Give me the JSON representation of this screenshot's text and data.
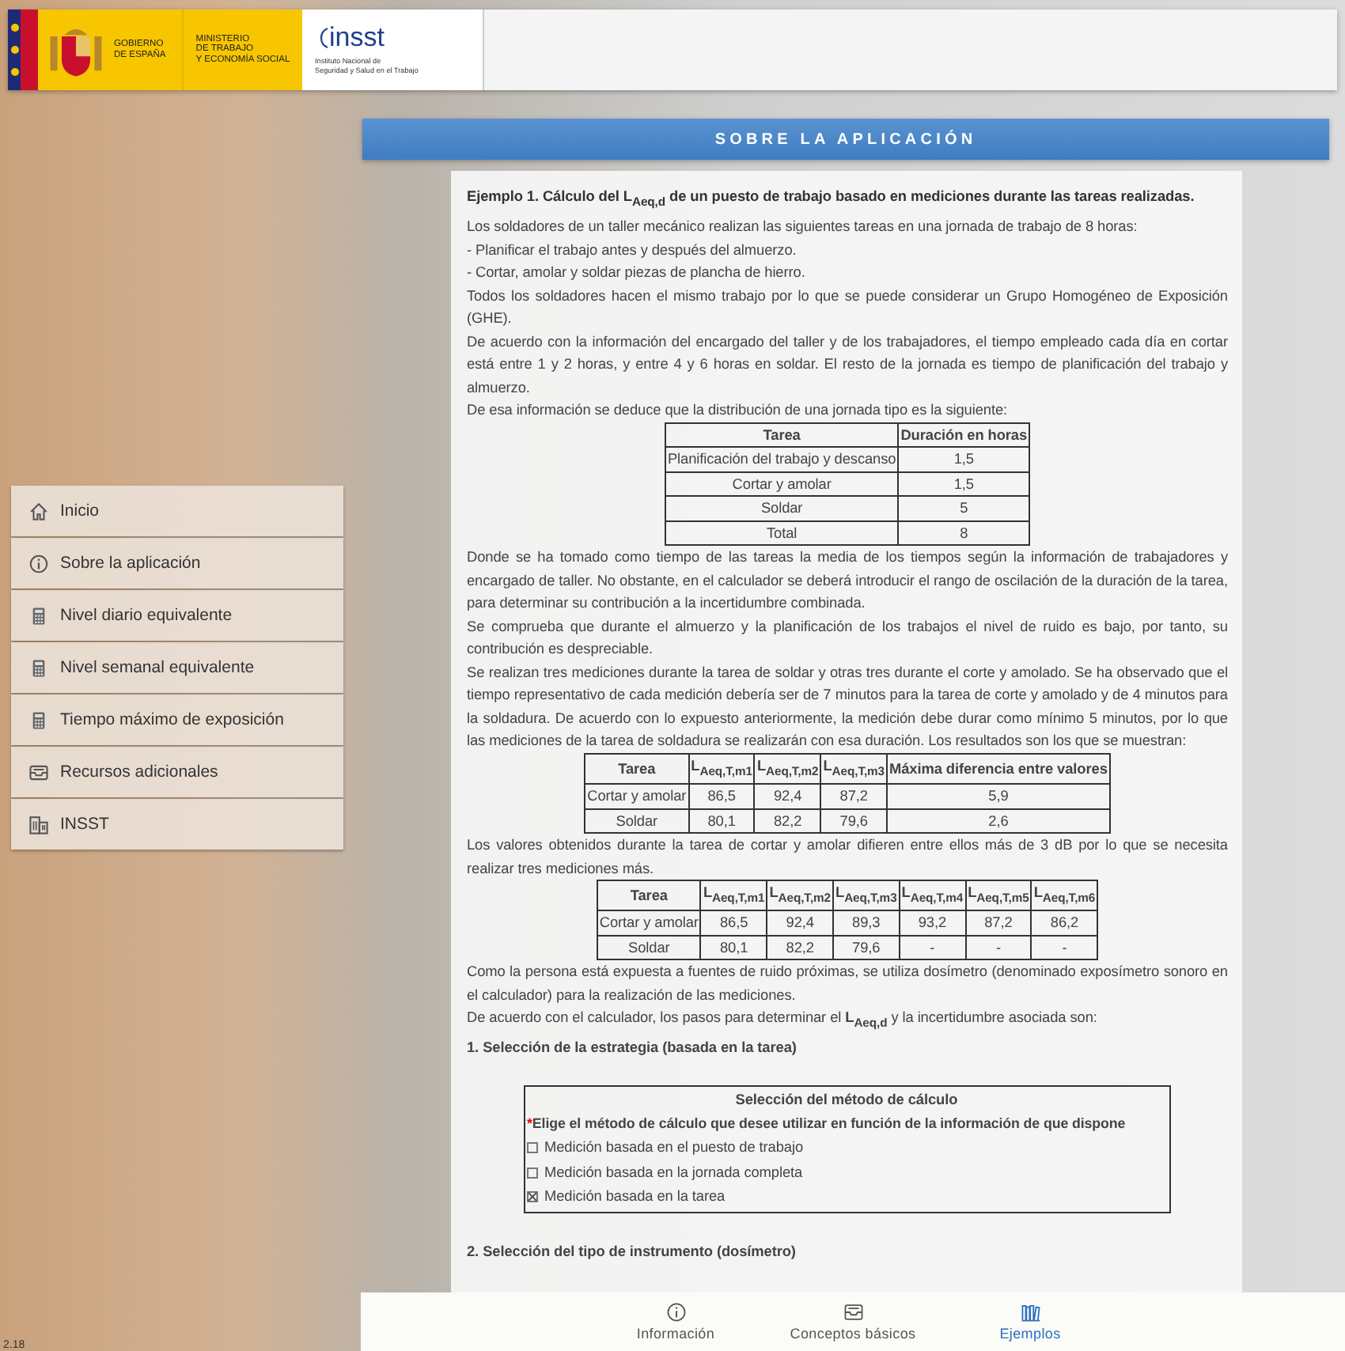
{
  "header": {
    "gov_lines": [
      "GOBIERNO",
      "DE ESPAÑA"
    ],
    "ministry_lines": [
      "MINISTERIO",
      "DE TRABAJO",
      "Y ECONOMÍA SOCIAL"
    ],
    "insst_name": "insst",
    "insst_lines": [
      "Instituto Nacional de",
      "Seguridad y Salud en el Trabajo"
    ]
  },
  "title": "SOBRE LA APLICACIÓN",
  "sidebar": {
    "items": [
      {
        "label": "Inicio",
        "kind": "home"
      },
      {
        "label": "Sobre la aplicación",
        "kind": "info"
      },
      {
        "label": "Nivel diario equivalente",
        "kind": "calculator"
      },
      {
        "label": "Nivel semanal equivalente",
        "kind": "calculator"
      },
      {
        "label": "Tiempo máximo de exposición",
        "kind": "calculator"
      },
      {
        "label": "Recursos adicionales",
        "kind": "tray"
      },
      {
        "label": "INSST",
        "kind": "building"
      }
    ]
  },
  "content": {
    "blocks": [
      {
        "kind": "heading",
        "text": "Ejemplo 1. Cálculo del L$_{Aeq,d}$ de un puesto de trabajo basado en mediciones durante las tareas realizadas."
      },
      {
        "kind": "paragraph",
        "text": "Los soldadores de un taller mecánico realizan las siguientes tareas en una jornada de trabajo de 8 horas:"
      },
      {
        "kind": "paragraph",
        "text": "- Planificar el trabajo antes y después del almuerzo."
      },
      {
        "kind": "paragraph",
        "text": "- Cortar, amolar y soldar piezas de plancha de hierro."
      },
      {
        "kind": "paragraph",
        "text": "Todos los soldadores hacen el mismo trabajo por lo que se puede considerar un Grupo Homogéneo de Exposición (GHE)."
      },
      {
        "kind": "paragraph",
        "text": "De acuerdo con la información del encargado del taller y de los trabajadores, el tiempo empleado cada día en cortar está entre 1 y 2 horas, y entre 4 y 6 horas en soldar. El resto de la jornada es tiempo de planificación del trabajo y almuerzo."
      },
      {
        "kind": "paragraph",
        "text": "De esa información se deduce que la distribución de una jornada tipo es la siguiente:"
      },
      {
        "kind": "table",
        "columns": [
          "Tarea",
          "Duración en horas"
        ],
        "rows": [
          [
            "Planificación del trabajo y descanso",
            "1,5"
          ],
          [
            "Cortar y amolar",
            "1,5"
          ],
          [
            "Soldar",
            "5"
          ],
          [
            "Total",
            "8"
          ]
        ]
      },
      {
        "kind": "paragraph",
        "text": "Donde se ha tomado como tiempo de las tareas la media de los tiempos según la información de trabajadores y encargado de taller. No obstante, en el calculador se deberá introducir el rango de oscilación de la duración de la tarea, para determinar su contribución a la incertidumbre combinada."
      },
      {
        "kind": "paragraph",
        "text": "Se comprueba que durante el almuerzo y la planificación de los trabajos el nivel de ruido es bajo, por tanto, su contribución es despreciable."
      },
      {
        "kind": "paragraph",
        "text": "Se realizan tres mediciones durante la tarea de soldar y otras tres durante el corte y amolado. Se ha observado que el tiempo representativo de cada medición debería ser de 7 minutos para la tarea de corte y amolado y de 4 minutos para la soldadura. De acuerdo con lo expuesto anteriormente, la medición debe durar como mínimo 5 minutos, por lo que las mediciones de la tarea de soldadura se realizarán con esa duración. Los resultados son los que se muestran:"
      },
      {
        "kind": "table",
        "columns": [
          "Tarea",
          "L$_{Aeq,T,m1}$",
          "L$_{Aeq,T,m2}$",
          "L$_{Aeq,T,m3}$",
          "Máxima diferencia entre valores"
        ],
        "rows": [
          [
            "Cortar y amolar",
            "86,5",
            "92,4",
            "87,2",
            "5,9"
          ],
          [
            "Soldar",
            "80,1",
            "82,2",
            "79,6",
            "2,6"
          ]
        ]
      },
      {
        "kind": "paragraph",
        "text": "Los valores obtenidos durante la tarea de cortar y amolar difieren entre ellos más de 3 dB por lo que se necesita realizar tres mediciones más."
      },
      {
        "kind": "table",
        "columns": [
          "Tarea",
          "L$_{Aeq,T,m1}$",
          "L$_{Aeq,T,m2}$",
          "L$_{Aeq,T,m3}$",
          "L$_{Aeq,T,m4}$",
          "L$_{Aeq,T,m5}$",
          "L$_{Aeq,T,m6}$"
        ],
        "rows": [
          [
            "Cortar y amolar",
            "86,5",
            "92,4",
            "89,3",
            "93,2",
            "87,2",
            "86,2"
          ],
          [
            "Soldar",
            "80,1",
            "82,2",
            "79,6",
            "-",
            "-",
            "-"
          ]
        ]
      },
      {
        "kind": "paragraph",
        "text": "Como la persona está expuesta a fuentes de ruido próximas, se utiliza dosímetro (denominado exposímetro sonoro en el calculador) para la realización de las mediciones."
      },
      {
        "kind": "paragraph",
        "text": "De acuerdo con el calculador, los pasos para determinar el **L$_{Aeq,d}$** y la incertidumbre asociada son:"
      },
      {
        "kind": "step",
        "text": "1. Selección de la estrategia (basada en la tarea)"
      },
      {
        "kind": "method_box",
        "title": "Selección del método de cálculo",
        "required_mark": "*",
        "prompt": "Elige el método de cálculo que desee utilizar en función de la información de que dispone",
        "options": [
          {
            "label": "Medición basada en el puesto de trabajo",
            "checked": false
          },
          {
            "label": "Medición basada en la jornada completa",
            "checked": false
          },
          {
            "label": "Medición basada en la tarea",
            "checked": true
          }
        ]
      },
      {
        "kind": "step",
        "text": "2. Selección del tipo de instrumento (dosímetro)"
      }
    ]
  },
  "bottom_nav": {
    "items": [
      {
        "label": "Información",
        "kind": "info",
        "selected": false
      },
      {
        "label": "Conceptos básicos",
        "kind": "tray",
        "selected": false
      },
      {
        "label": "Ejemplos",
        "kind": "books",
        "selected": true
      }
    ]
  },
  "version": "2.18"
}
